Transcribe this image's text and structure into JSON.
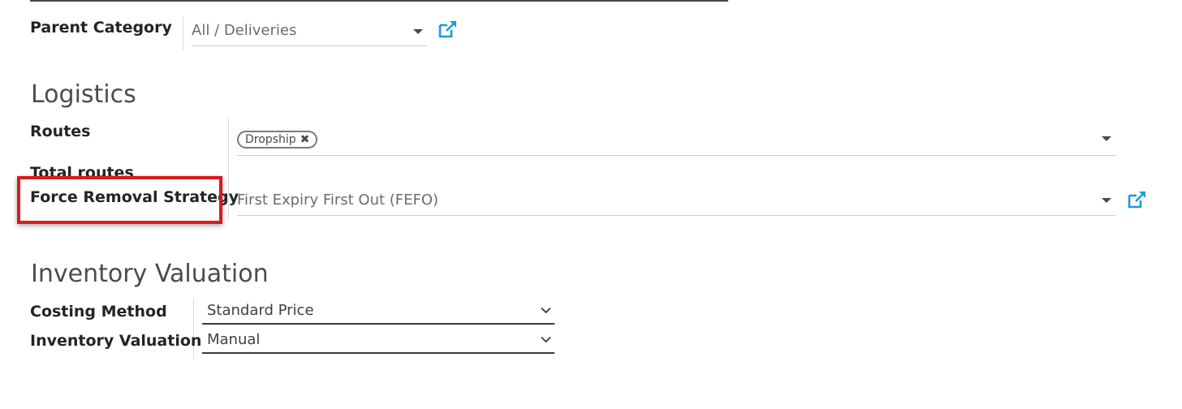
{
  "general": {
    "parent_category": {
      "label": "Parent Category",
      "value": "All / Deliveries"
    }
  },
  "logistics": {
    "title": "Logistics",
    "routes": {
      "label": "Routes",
      "tags": [
        "Dropship"
      ]
    },
    "total_routes": {
      "label": "Total routes"
    },
    "force_removal_strategy": {
      "label": "Force Removal Strategy",
      "value": "First Expiry First Out (FEFO)"
    }
  },
  "inventory_valuation": {
    "title": "Inventory Valuation",
    "costing_method": {
      "label": "Costing Method",
      "value": "Standard Price"
    },
    "valuation": {
      "label": "Inventory Valuation",
      "value": "Manual"
    }
  },
  "icons": {
    "external_link": "external-link-icon",
    "dropdown": "caret-down-icon",
    "select": "chevron-down-icon",
    "tag_remove": "close-icon"
  },
  "colors": {
    "link_blue": "#1a9bd7",
    "highlight_red": "#d71c1c"
  }
}
